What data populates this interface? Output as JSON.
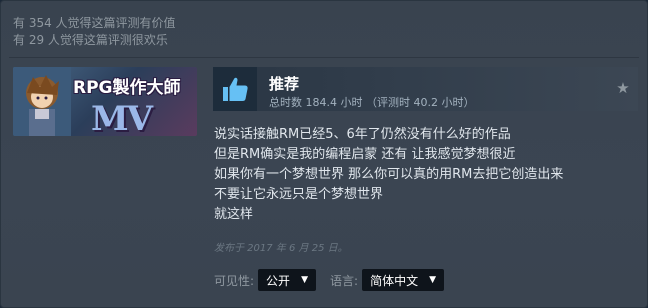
{
  "stats": {
    "helpful": "有 354 人觉得这篇评测有价值",
    "funny": "有 29 人觉得这篇评测很欢乐"
  },
  "game": {
    "capsule_text": "RPG製作大師",
    "capsule_logo_text": "MV"
  },
  "review": {
    "verdict": "推荐",
    "hours": "总时数 184.4 小时 （评测时 40.2 小时）",
    "thumb_icon": "thumbs-up-icon",
    "award_icon": "star-icon",
    "lines": [
      "说实话接触RM已经5、6年了仍然没有什么好的作品",
      "但是RM确实是我的编程启蒙 还有 让我感觉梦想很近",
      "如果你有一个梦想世界 那么你可以真的用RM去把它创造出来",
      "不要让它永远只是个梦想世界",
      "就这样"
    ],
    "posted": "发布于 2017 年 6 月 25 日。"
  },
  "controls": {
    "visibility_label": "可见性:",
    "visibility_value": "公开",
    "language_label": "语言:",
    "language_value": "简体中文"
  },
  "colors": {
    "panel_bg": "#3b4552",
    "thumb_blue": "#66c0f4",
    "text_light": "#e0e6ec",
    "muted": "#8f98a0"
  }
}
